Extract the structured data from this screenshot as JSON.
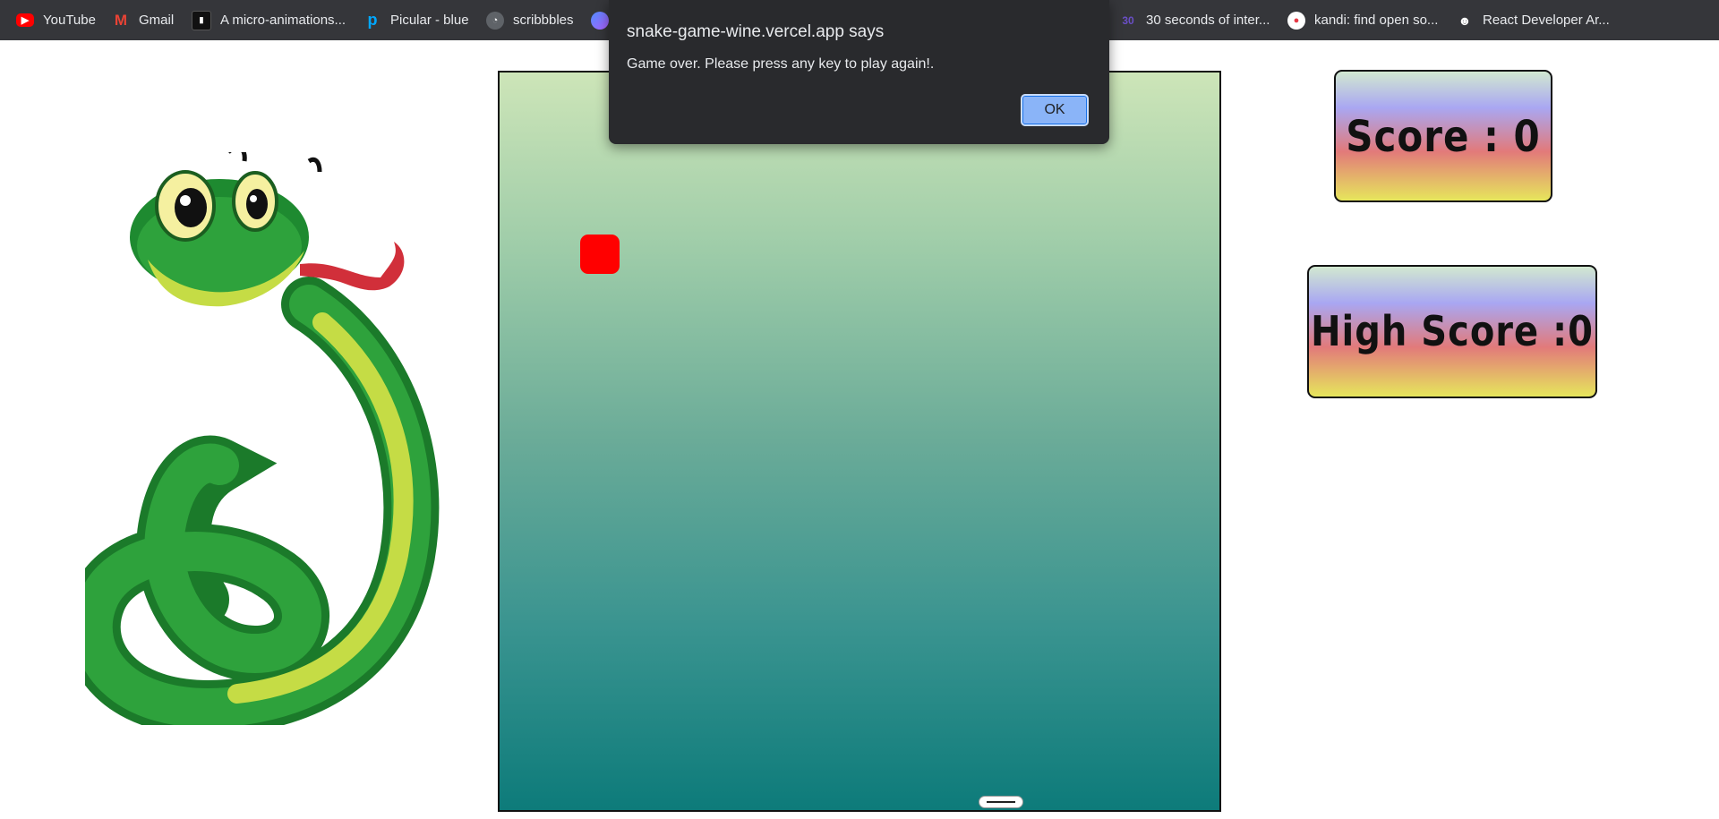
{
  "bookmarks": [
    {
      "label": "YouTube",
      "icon": "youtube-icon",
      "color": "#ff0000"
    },
    {
      "label": "Gmail",
      "icon": "gmail-icon",
      "color": "#ea4335"
    },
    {
      "label": "A micro-animations...",
      "icon": "micro-animations-icon",
      "color": "#111111"
    },
    {
      "label": "Picular - blue",
      "icon": "picular-icon",
      "color": "#00a8ff"
    },
    {
      "label": "scribbbles",
      "icon": "scribbbles-icon",
      "color": "#5f6368"
    },
    {
      "label": "",
      "icon": "app-icon",
      "color": "#7b61ff"
    },
    {
      "label": "30 seconds of inter...",
      "icon": "30-seconds-icon",
      "color": "#6a4fc7"
    },
    {
      "label": "kandi: find open so...",
      "icon": "kandi-icon",
      "color": "#e63946"
    },
    {
      "label": "React Developer Ar...",
      "icon": "react-dev-icon",
      "color": "#ffffff"
    }
  ],
  "dialog": {
    "title": "snake-game-wine.vercel.app says",
    "message": "Game over. Please press any key to play again!.",
    "ok_label": "OK"
  },
  "score": {
    "label": "Score : 0"
  },
  "high_score": {
    "label": "High Score :0"
  },
  "colors": {
    "food": "#ff0000",
    "dialog_bg": "#292a2d",
    "ok_button": "#8ab4f8"
  }
}
